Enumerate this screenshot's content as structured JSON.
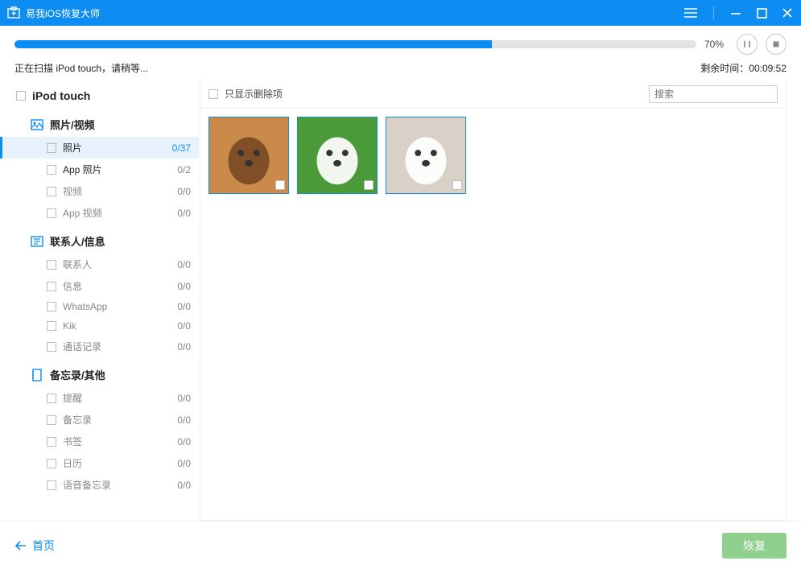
{
  "window": {
    "title": "易我iOS恢复大师"
  },
  "progress": {
    "percent": 70,
    "percent_label": "70%",
    "status_text": "正在扫描 iPod touch，请稍等...",
    "remaining_label": "剩余时间：",
    "remaining_value": "00:09:52"
  },
  "tree": {
    "root_label": "iPod touch",
    "categories": [
      {
        "label": "照片/视频",
        "icon": "picture-icon",
        "items": [
          {
            "label": "照片",
            "count": "0/37",
            "active": true,
            "dark": true
          },
          {
            "label": "App 照片",
            "count": "0/2",
            "dark": true
          },
          {
            "label": "视频",
            "count": "0/0"
          },
          {
            "label": "App 视频",
            "count": "0/0"
          }
        ]
      },
      {
        "label": "联系人/信息",
        "icon": "contacts-icon",
        "items": [
          {
            "label": "联系人",
            "count": "0/0"
          },
          {
            "label": "信息",
            "count": "0/0"
          },
          {
            "label": "WhatsApp",
            "count": "0/0"
          },
          {
            "label": "Kik",
            "count": "0/0"
          },
          {
            "label": "通话记录",
            "count": "0/0"
          }
        ]
      },
      {
        "label": "备忘录/其他",
        "icon": "memo-icon",
        "items": [
          {
            "label": "提醒",
            "count": "0/0"
          },
          {
            "label": "备忘录",
            "count": "0/0"
          },
          {
            "label": "书签",
            "count": "0/0"
          },
          {
            "label": "日历",
            "count": "0/0"
          },
          {
            "label": "语音备忘录",
            "count": "0/0"
          }
        ]
      }
    ]
  },
  "content": {
    "show_deleted_label": "只显示删除项",
    "search_placeholder": "搜索",
    "thumbnails": [
      {
        "name": "photo-1",
        "bg": "#c98a4a",
        "accent": "#7a4a24"
      },
      {
        "name": "photo-2",
        "bg": "#4a9a3a",
        "accent": "#ffffff"
      },
      {
        "name": "photo-3",
        "bg": "#d9d0c8",
        "accent": "#ffffff"
      }
    ]
  },
  "footer": {
    "home_label": "首页",
    "recover_label": "恢复"
  }
}
